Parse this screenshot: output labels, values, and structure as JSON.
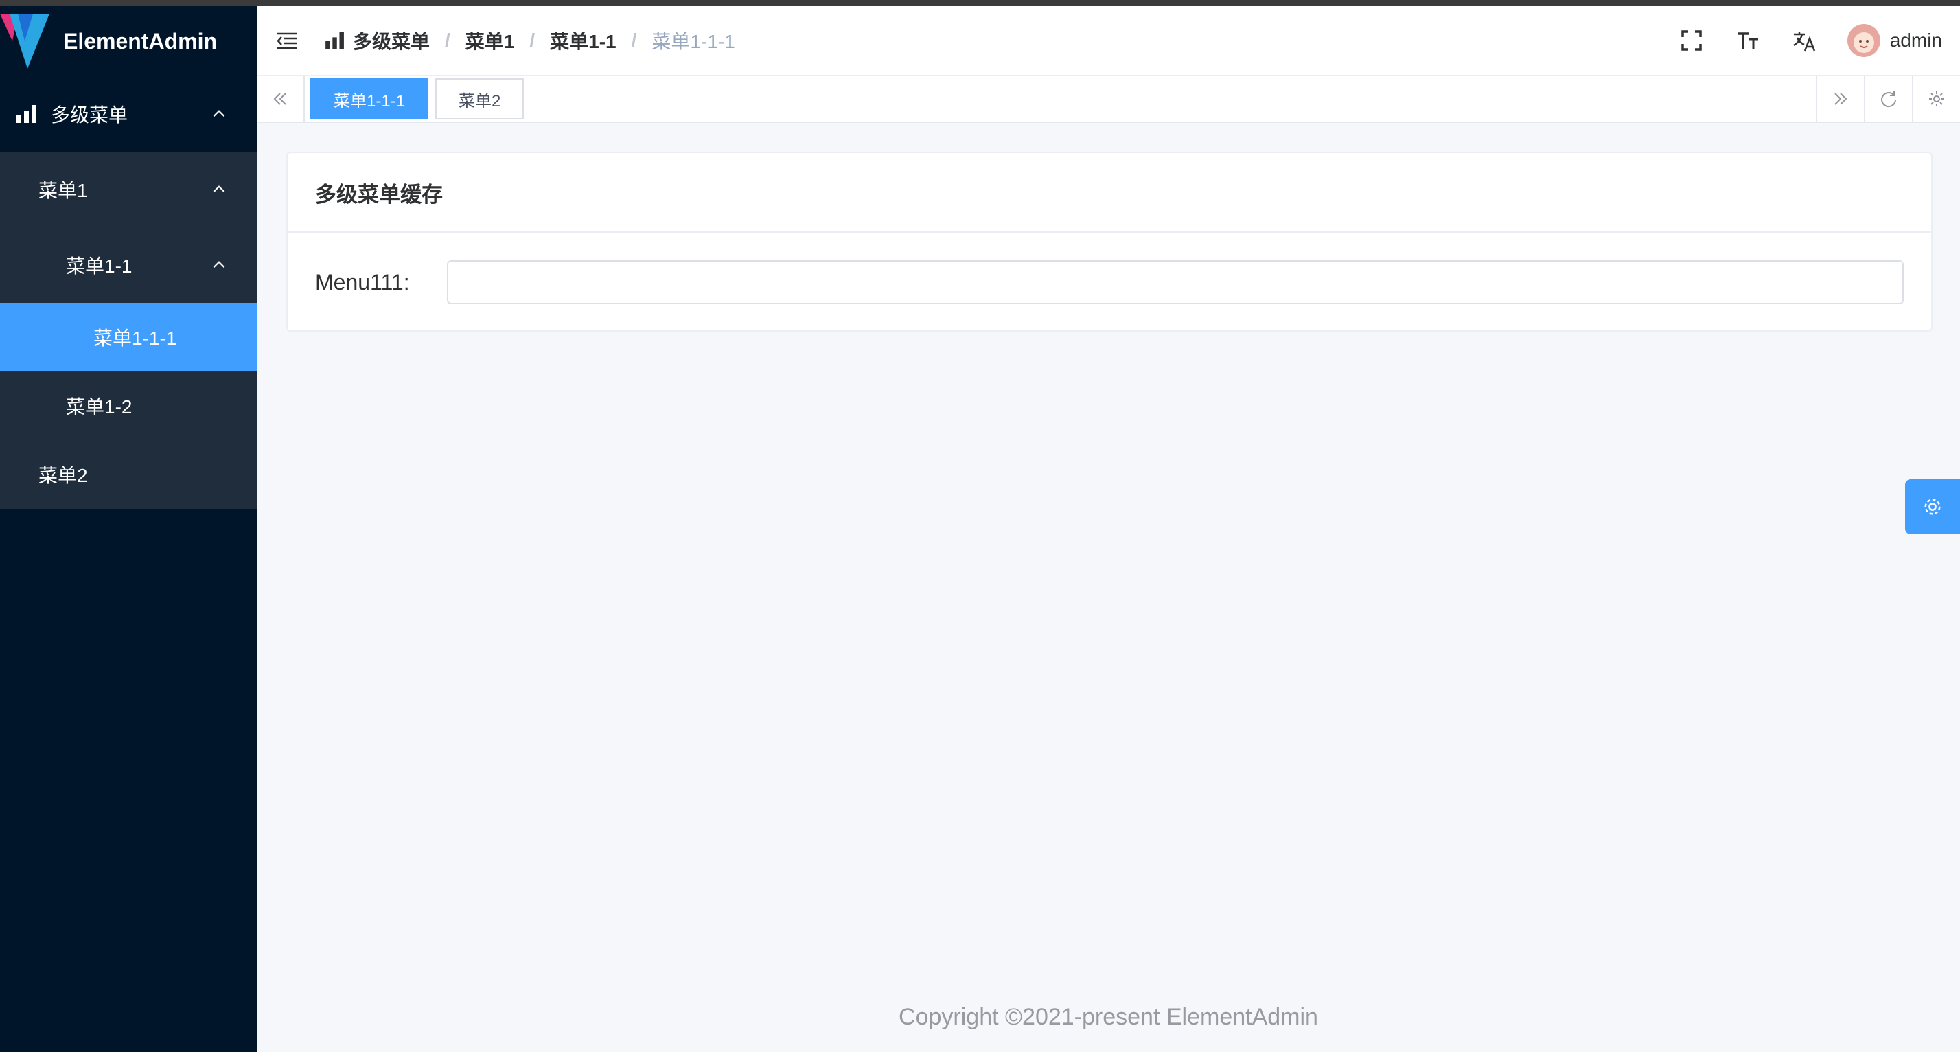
{
  "app": {
    "name": "ElementAdmin"
  },
  "sidebar": {
    "items": [
      {
        "label": "多级菜单",
        "icon": "bar-chart-icon"
      },
      {
        "label": "菜单1"
      },
      {
        "label": "菜单1-1"
      },
      {
        "label": "菜单1-1-1",
        "active": true
      },
      {
        "label": "菜单1-2"
      },
      {
        "label": "菜单2"
      }
    ]
  },
  "breadcrumb": {
    "items": [
      "多级菜单",
      "菜单1",
      "菜单1-1",
      "菜单1-1-1"
    ],
    "separator": "/"
  },
  "header": {
    "user": "admin"
  },
  "tags": [
    {
      "label": "菜单1-1-1",
      "active": true
    },
    {
      "label": "菜单2",
      "active": false
    }
  ],
  "card": {
    "title": "多级菜单缓存",
    "field_label": "Menu111:",
    "field_value": ""
  },
  "footer": {
    "text": "Copyright ©2021-present ElementAdmin"
  },
  "colors": {
    "primary": "#409eff",
    "sidebar": "#001529",
    "submenu": "#1f2d3d"
  }
}
